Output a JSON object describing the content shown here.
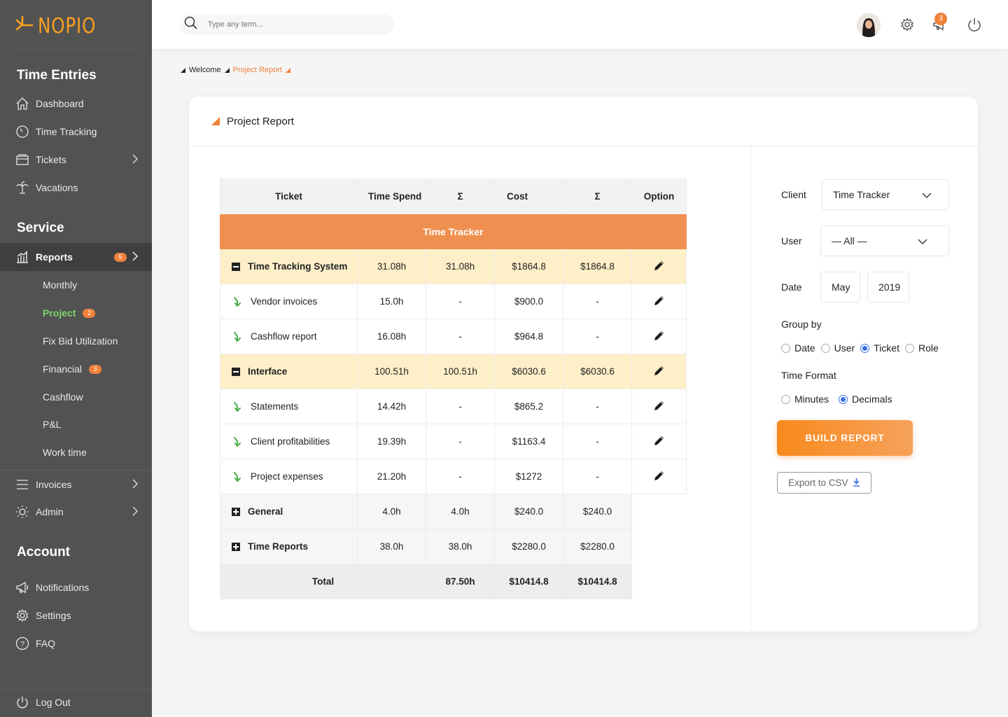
{
  "brand": {
    "name": "NOPIO",
    "accent": "#f0813a",
    "logo_color": "#f8a020"
  },
  "sidebar": {
    "sections": [
      {
        "title": "Time Entries"
      },
      {
        "title": "Service"
      },
      {
        "title": "Account"
      }
    ],
    "time_entries": [
      {
        "label": "Dashboard",
        "icon": "home-icon"
      },
      {
        "label": "Time Tracking",
        "icon": "clock-icon"
      },
      {
        "label": "Tickets",
        "icon": "ticket-icon"
      },
      {
        "label": "Vacations",
        "icon": "palm-tree-icon"
      }
    ],
    "reports": {
      "label": "Reports",
      "badge": "5"
    },
    "report_subitems": [
      {
        "label": "Monthly"
      },
      {
        "label": "Project",
        "badge": "2"
      },
      {
        "label": "Fix Bid Utilization"
      },
      {
        "label": "Financial",
        "badge": "3"
      },
      {
        "label": "Cashflow"
      },
      {
        "label": "P&L"
      },
      {
        "label": "Work time"
      }
    ],
    "service_more": [
      {
        "label": "Invoices",
        "icon": "list-icon"
      },
      {
        "label": "Admin",
        "icon": "sun-icon"
      }
    ],
    "account": [
      {
        "label": "Notifications",
        "icon": "megaphone-icon"
      },
      {
        "label": "Settings",
        "icon": "gear-icon"
      },
      {
        "label": "FAQ",
        "icon": "question-icon"
      }
    ],
    "logout": "Log Out"
  },
  "topbar": {
    "search_placeholder": "Type any term...",
    "notifications_count": "3"
  },
  "breadcrumb": {
    "home": "Welcome",
    "current": "Project Report"
  },
  "card": {
    "title": "Project Report"
  },
  "table": {
    "headers": {
      "ticket": "Ticket",
      "time_spend": "Time Spend",
      "sigma1": "Σ",
      "cost": "Cost",
      "sigma2": "Σ",
      "option": "Option"
    },
    "group_banner": "Time Tracker",
    "rows": [
      {
        "name": "Time Tracking System",
        "time": "31.08h",
        "time_sum": "31.08h",
        "cost": "$1864.8",
        "cost_sum": "$1864.8"
      },
      {
        "name": "Vendor invoices",
        "time": "15.0h",
        "time_sum": "-",
        "cost": "$900.0",
        "cost_sum": "-"
      },
      {
        "name": "Cashflow report",
        "time": "16.08h",
        "time_sum": "-",
        "cost": "$964.8",
        "cost_sum": "-"
      },
      {
        "name": "Interface",
        "time": "100.51h",
        "time_sum": "100.51h",
        "cost": "$6030.6",
        "cost_sum": "$6030.6"
      },
      {
        "name": "Statements",
        "time": "14.42h",
        "time_sum": "-",
        "cost": "$865.2",
        "cost_sum": "-"
      },
      {
        "name": "Client profitabilities",
        "time": "19.39h",
        "time_sum": "-",
        "cost": "$1163.4",
        "cost_sum": "-"
      },
      {
        "name": "Project expenses",
        "time": "21.20h",
        "time_sum": "-",
        "cost": "$1272",
        "cost_sum": "-"
      },
      {
        "name": "General",
        "time": "4.0h",
        "time_sum": "4.0h",
        "cost": "$240.0",
        "cost_sum": "$240.0"
      },
      {
        "name": "Time Reports",
        "time": "38.0h",
        "time_sum": "38.0h",
        "cost": "$2280.0",
        "cost_sum": "$2280.0"
      }
    ],
    "total": {
      "label": "Total",
      "time_sum": "87.50h",
      "cost": "$10414.8",
      "cost_sum": "$10414.8"
    }
  },
  "filters": {
    "client_label": "Client",
    "client_value": "Time Tracker",
    "user_label": "User",
    "user_value": "— All —",
    "date_label": "Date",
    "date_month": "May",
    "date_year": "2019",
    "group_by_label": "Group by",
    "group_by_options": [
      "Date",
      "User",
      "Ticket",
      "Role"
    ],
    "group_by_selected": "Ticket",
    "time_format_label": "Time Format",
    "time_format_options": [
      "Minutes",
      "Decimals"
    ],
    "time_format_selected": "Decimals",
    "build_button": "BUILD REPORT",
    "export_button": "Export to CSV"
  }
}
